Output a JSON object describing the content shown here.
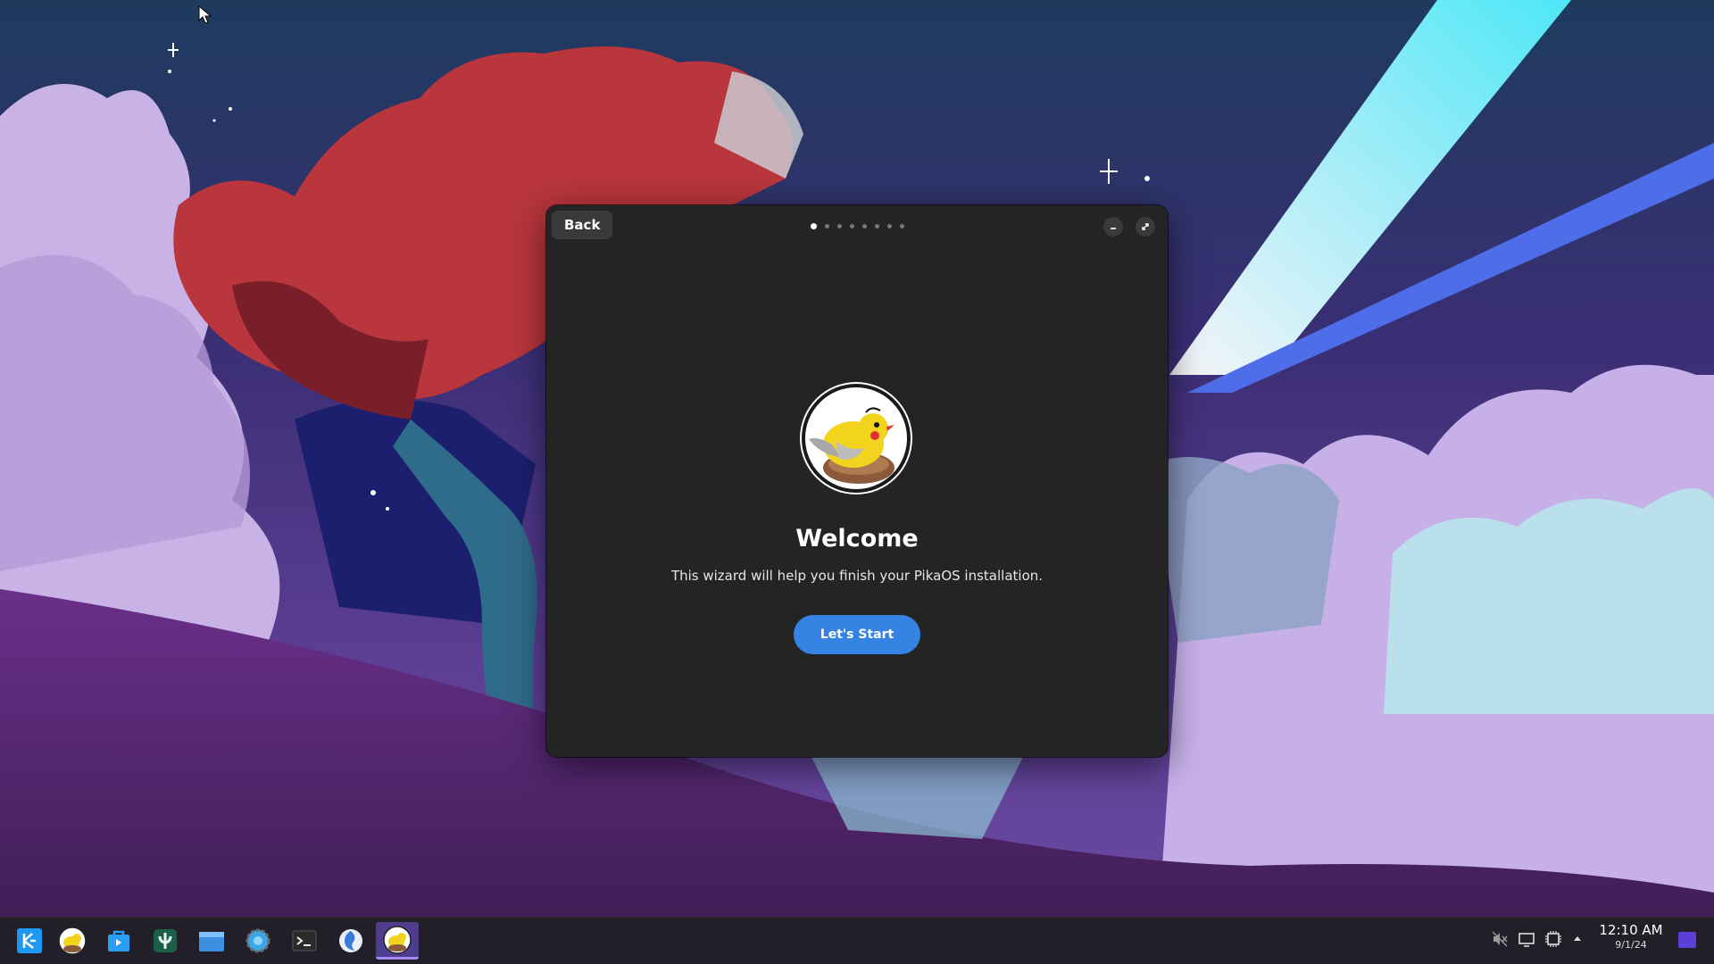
{
  "window": {
    "back_label": "Back",
    "page_count": 8,
    "active_page": 1,
    "title": "Welcome",
    "subtitle": "This wizard will help you finish your PikaOS installation.",
    "start_label": "Let's Start"
  },
  "taskbar": {
    "apps": [
      {
        "name": "kde-launcher-icon",
        "active": false
      },
      {
        "name": "pika-welcome-icon",
        "active": false
      },
      {
        "name": "software-store-icon",
        "active": false
      },
      {
        "name": "kde-connect-icon",
        "active": false
      },
      {
        "name": "file-manager-icon",
        "active": false
      },
      {
        "name": "system-settings-icon",
        "active": false
      },
      {
        "name": "terminal-icon",
        "active": false
      },
      {
        "name": "web-browser-icon",
        "active": false
      },
      {
        "name": "pika-first-setup-icon",
        "active": true
      }
    ],
    "tray_icons": [
      "volume-muted-icon",
      "display-icon",
      "cpu-icon",
      "tray-expand-icon"
    ],
    "clock_time": "12:10 AM",
    "clock_date": "9/1/24"
  },
  "colors": {
    "accent": "#3584e4",
    "window_bg": "#242424",
    "taskbar_active": "#4d3d8c"
  }
}
